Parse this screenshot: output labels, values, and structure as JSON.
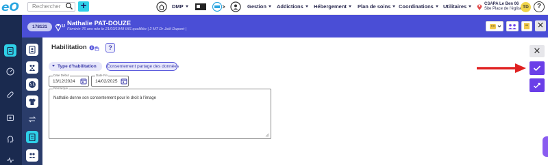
{
  "app": {
    "logo": "eO"
  },
  "topbar": {
    "search_placeholder": "Rechercher",
    "plus_label": "+",
    "menu": [
      {
        "label": "DMP"
      },
      {
        "label": "Gestion"
      },
      {
        "label": "Addictions"
      },
      {
        "label": "Hébergement"
      },
      {
        "label": "Plan de soins"
      },
      {
        "label": "Coordinations"
      },
      {
        "label": "Utilitaires"
      }
    ],
    "org_name": "CSAPA Le Ben 06",
    "org_site": "Site Place de l'église",
    "user_initials": "TD",
    "help_label": "?"
  },
  "patient": {
    "id": "178131",
    "tag": "U",
    "name": "Nathalie PAT-DOUZE",
    "info": "Féminin 76 ans née le 21/03/1948 INS qualifiée | 2 MT Dr Joël Dupont |",
    "close_label": "✕"
  },
  "panel": {
    "title": "Habilitation",
    "help_label": "?",
    "type_tab": "Type d'habilitation",
    "selected_type": "Consentement partage des données",
    "date_debut": {
      "label": "Date Début",
      "value": "13/12/2024"
    },
    "date_fin": {
      "label": "Date Fin",
      "value": "14/02/2025"
    },
    "remarque": {
      "label": "Remarque",
      "value": "Nathalie donne son consentement pour le droit à l'image"
    }
  },
  "actions": {
    "close_label": "✕"
  },
  "colors": {
    "accent": "#4a4ed6",
    "action": "#6a3ee8",
    "rail": "#1a2a4f",
    "highlight": "#2fd0e8",
    "arrow": "#e02020"
  }
}
